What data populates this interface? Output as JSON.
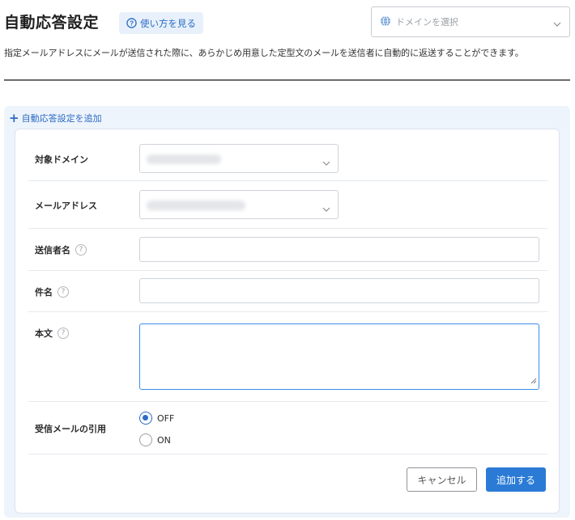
{
  "header": {
    "title": "自動応答設定",
    "help_label": "使い方を見る",
    "domain_select_placeholder": "ドメインを選択"
  },
  "description": "指定メールアドレスにメールが送信された際に、あらかじめ用意した定型文のメールを送信者に自動的に返送することができます。",
  "panel": {
    "add_link_label": "自動応答設定を追加"
  },
  "form": {
    "target_domain_label": "対象ドメイン",
    "email_label": "メールアドレス",
    "sender_name_label": "送信者名",
    "subject_label": "件名",
    "body_label": "本文",
    "quote_label": "受信メールの引用",
    "quote_options": [
      {
        "label": "OFF",
        "selected": true
      },
      {
        "label": "ON",
        "selected": false
      }
    ],
    "help_mark": "?"
  },
  "actions": {
    "cancel_label": "キャンセル",
    "submit_label": "追加する"
  },
  "colors": {
    "accent": "#2b7bd6",
    "link": "#2b6cc4",
    "panel_bg": "#eef4fb"
  }
}
